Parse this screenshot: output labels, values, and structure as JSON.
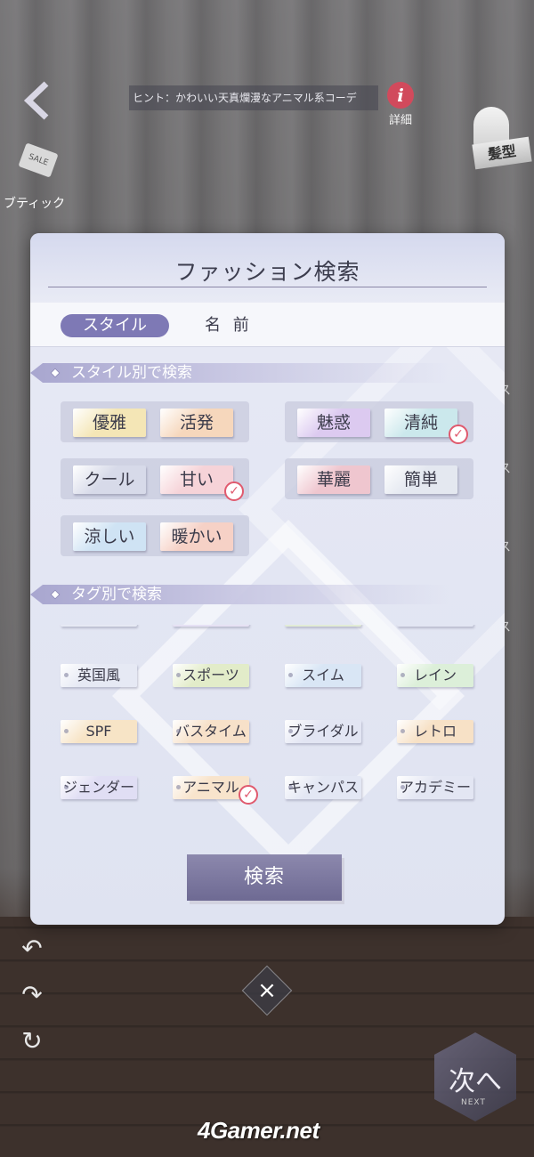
{
  "hud": {
    "hint_text": "ヒント：かわいい天真爛漫なアニマル系コーデ",
    "info_label": "詳細",
    "hair_label": "髪型",
    "boutique_label": "ブティック",
    "sale_tag": "SALE",
    "right_side_labels": [
      "ス",
      "ス",
      "ス",
      "ス"
    ],
    "next_label": "次へ",
    "next_sub": "NEXT",
    "close_glyph": "×",
    "watermark": "4Gamer.net"
  },
  "dialog": {
    "title": "ファッション検索",
    "tabs": {
      "style_label": "スタイル",
      "name_label": "名 前"
    },
    "style_section_label": "スタイル別で検索",
    "tag_section_label": "タグ別で検索",
    "style_chips": [
      {
        "label": "優雅",
        "color": "#f4e6b6",
        "selected": false
      },
      {
        "label": "活発",
        "color": "#f6d7bc",
        "selected": false
      },
      {
        "label": "魅惑",
        "color": "#dccaf0",
        "selected": false
      },
      {
        "label": "清純",
        "color": "#cbe8ec",
        "selected": true
      },
      {
        "label": "クール",
        "color": "#d7dae9",
        "selected": false
      },
      {
        "label": "甘い",
        "color": "#f6d3d8",
        "selected": true
      },
      {
        "label": "華麗",
        "color": "#efc6cf",
        "selected": false
      },
      {
        "label": "簡単",
        "color": "#e4e8f0",
        "selected": false
      },
      {
        "label": "涼しい",
        "color": "#cfe3f4",
        "selected": false
      },
      {
        "label": "暖かい",
        "color": "#f6d1c6",
        "selected": false
      }
    ],
    "tags": [
      {
        "label": "英国風",
        "color": "#e6e9f4",
        "selected": false
      },
      {
        "label": "スポーツ",
        "color": "#e2ecc9",
        "selected": false
      },
      {
        "label": "スイム",
        "color": "#d9e6f5",
        "selected": false
      },
      {
        "label": "レイン",
        "color": "#dcefd9",
        "selected": false
      },
      {
        "label": "SPF",
        "color": "#f7e4c6",
        "selected": false
      },
      {
        "label": "バスタイム",
        "color": "#f7e1c9",
        "selected": false
      },
      {
        "label": "ブライダル",
        "color": "#e2e5f3",
        "selected": false
      },
      {
        "label": "レトロ",
        "color": "#f7e1c6",
        "selected": false
      },
      {
        "label": "ジェンダー",
        "color": "#e0def4",
        "selected": false
      },
      {
        "label": "アニマル",
        "color": "#f8e4cc",
        "selected": true
      },
      {
        "label": "キャンパス",
        "color": "#e3e7f4",
        "selected": false
      },
      {
        "label": "アカデミー",
        "color": "#e3e6f3",
        "selected": false
      }
    ],
    "search_button_label": "検索",
    "check_glyph": "✓"
  }
}
